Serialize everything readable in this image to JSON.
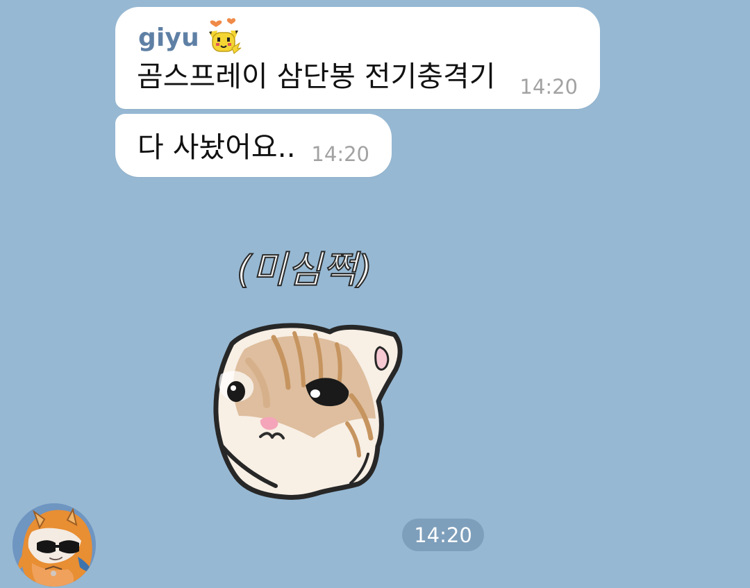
{
  "chat": {
    "messages": [
      {
        "sender": "giyu",
        "text": "곰스프레이 삼단봉 전기충격기",
        "time": "14:20"
      },
      {
        "text": "다 사놨어요..",
        "time": "14:20"
      }
    ],
    "sticker": {
      "caption": "(미심쩍)",
      "icon": "cat-sticker"
    },
    "sticker_time": "14:20"
  },
  "icons": {
    "sender_badge": "pikachu-badge-icon",
    "avatar": "charizard-hood-avatar-icon"
  },
  "colors": {
    "background": "#96b8d3",
    "bubble": "#ffffff",
    "sender_name": "#5f80a5",
    "timestamp": "#a2a2a2",
    "time_chip_text": "#ffffff"
  }
}
